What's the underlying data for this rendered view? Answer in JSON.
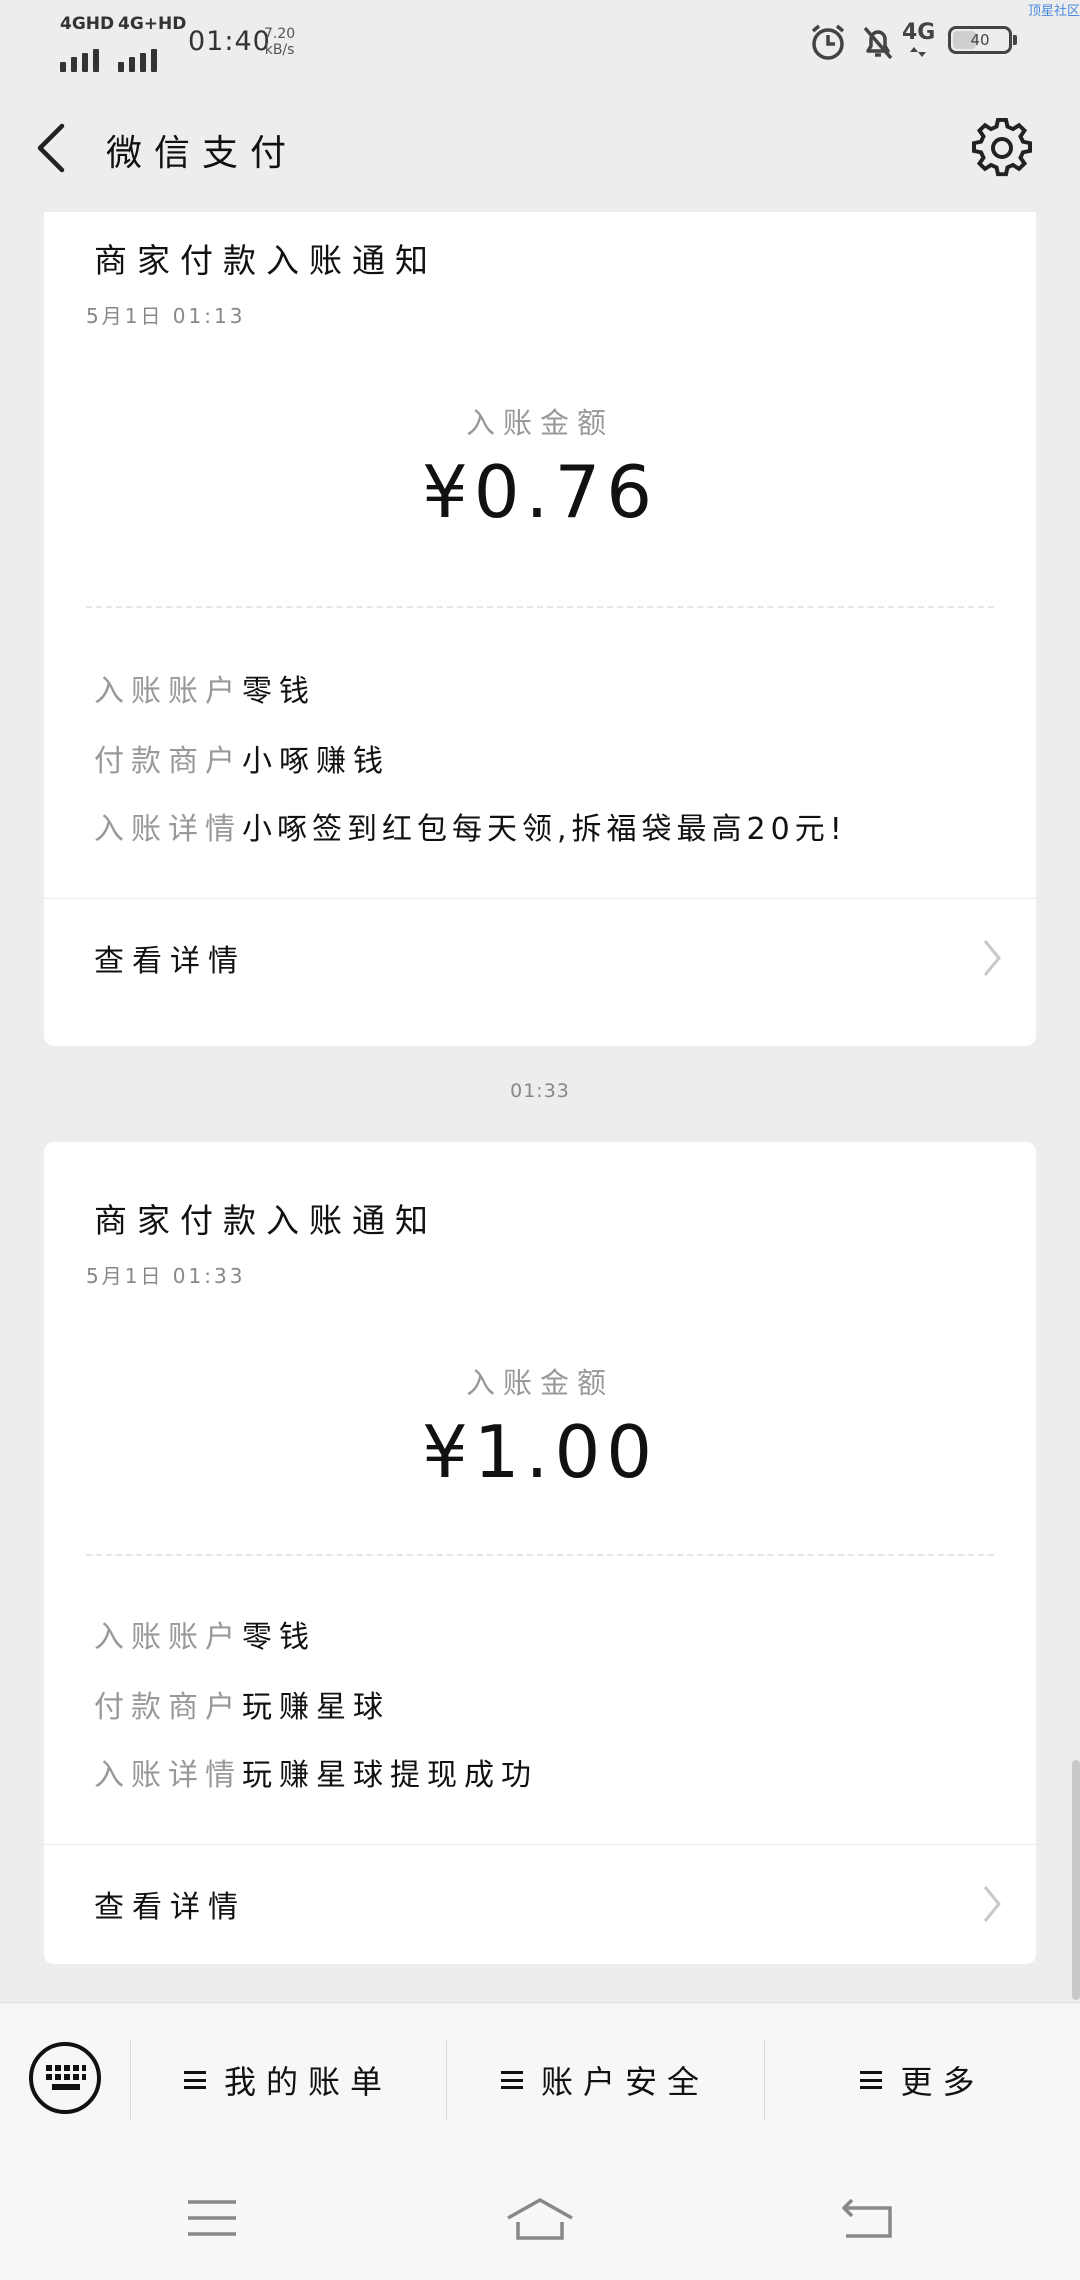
{
  "status_bar": {
    "signal1_label": "4GHD",
    "signal2_label": "4G+HD",
    "time": "01:40",
    "speed_value": "7.20",
    "speed_unit": "kB/s",
    "network": "4G",
    "battery": "40",
    "watermark": "顶星社区",
    "icons": [
      "alarm-icon",
      "mute-bell-icon",
      "network-4g-icon",
      "battery-icon"
    ]
  },
  "navbar": {
    "back_icon": "back-chevron-icon",
    "title": "微信支付",
    "settings_icon": "gear-icon"
  },
  "messages": [
    {
      "title": "商家付款入账通知",
      "date": "5月1日  01:13",
      "amount_label": "入账金额",
      "amount": "¥0.76",
      "rows": [
        {
          "key": "入账账户",
          "value": "零钱"
        },
        {
          "key": "付款商户",
          "value": "小啄赚钱"
        },
        {
          "key": "入账详情",
          "value": "小啄签到红包每天领,拆福袋最高20元!"
        }
      ],
      "detail_label": "查看详情"
    },
    {
      "time_separator": "01:33",
      "title": "商家付款入账通知",
      "date": "5月1日  01:33",
      "amount_label": "入账金额",
      "amount": "¥1.00",
      "rows": [
        {
          "key": "入账账户",
          "value": "零钱"
        },
        {
          "key": "付款商户",
          "value": "玩赚星球"
        },
        {
          "key": "入账详情",
          "value": "玩赚星球提现成功"
        }
      ],
      "detail_label": "查看详情"
    }
  ],
  "bottom_menu": {
    "keyboard_icon": "keyboard-icon",
    "items": [
      {
        "label": "我的账单"
      },
      {
        "label": "账户安全"
      },
      {
        "label": "更多"
      }
    ]
  },
  "system_nav": {
    "icons": [
      "menu-icon",
      "home-icon",
      "back-icon"
    ]
  }
}
